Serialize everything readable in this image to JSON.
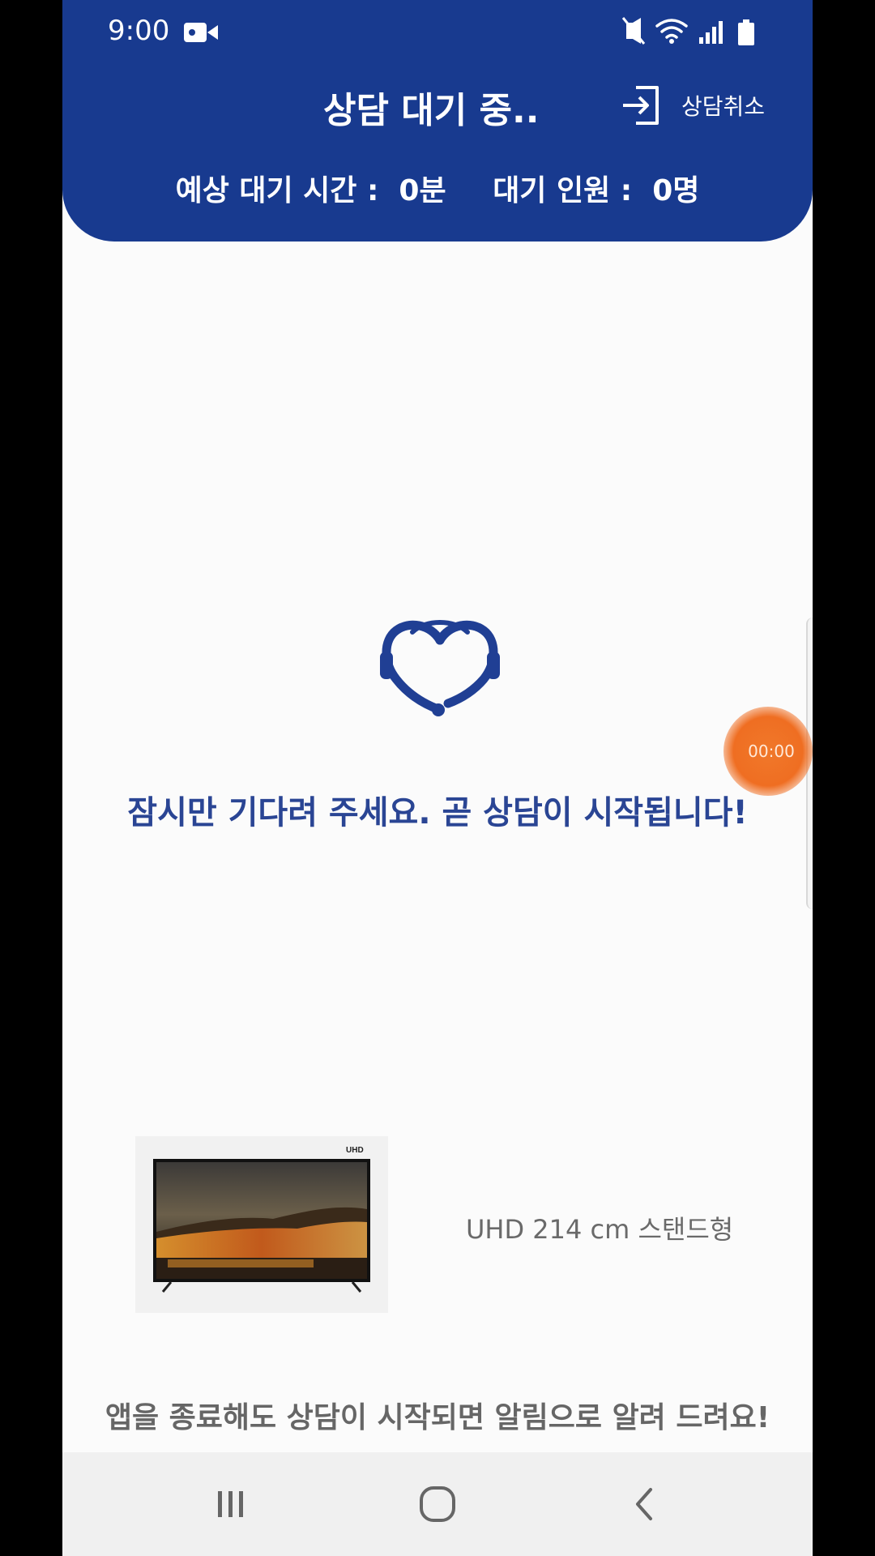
{
  "status_bar": {
    "time": "9:00",
    "icons": [
      "video-camera-icon",
      "mute-vibrate-icon",
      "wifi-icon",
      "signal-icon",
      "battery-icon"
    ]
  },
  "header": {
    "title": "상담 대기 중..",
    "cancel_label": "상담취소",
    "wait_time": "예상 대기 시간 :  0분",
    "wait_count": "대기 인원 :  0명"
  },
  "main": {
    "message": "잠시만 기다려 주세요. 곧 상담이 시작됩니다!"
  },
  "timer": {
    "value": "00:00"
  },
  "product": {
    "badge": "UHD",
    "name": "UHD 214 cm 스탠드형"
  },
  "notice": "앱을 종료해도 상담이 시작되면 알림으로 알려 드려요!",
  "colors": {
    "header_bg": "#183a8f",
    "accent_text": "#2a4594",
    "timer_orange": "#ef6e22"
  }
}
